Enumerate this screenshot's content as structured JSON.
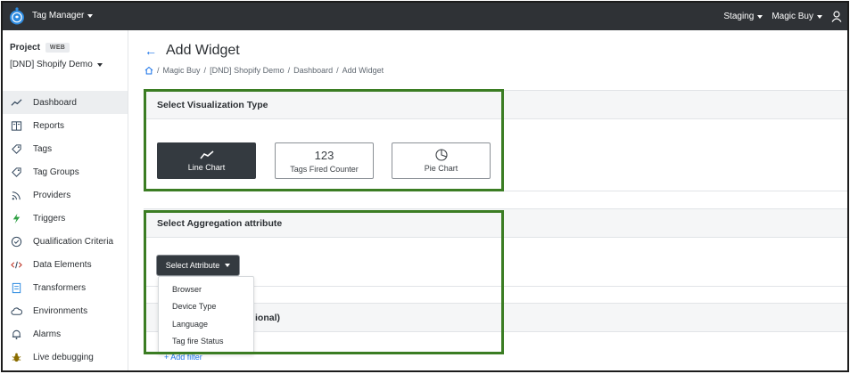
{
  "topbar": {
    "app_name": "Tag Manager",
    "environment": "Staging",
    "account": "Magic Buy"
  },
  "sidebar": {
    "project_label": "Project",
    "project_badge": "WEB",
    "project_name": "[DND] Shopify Demo",
    "items": [
      {
        "label": "Dashboard",
        "icon": "trend-icon",
        "active": true
      },
      {
        "label": "Reports",
        "icon": "book-icon"
      },
      {
        "label": "Tags",
        "icon": "tag-icon"
      },
      {
        "label": "Tag Groups",
        "icon": "tag-icon"
      },
      {
        "label": "Providers",
        "icon": "rss-icon"
      },
      {
        "label": "Triggers",
        "icon": "bolt-icon"
      },
      {
        "label": "Qualification Criteria",
        "icon": "check-circle-icon"
      },
      {
        "label": "Data Elements",
        "icon": "code-icon"
      },
      {
        "label": "Transformers",
        "icon": "file-icon"
      },
      {
        "label": "Environments",
        "icon": "cloud-icon"
      },
      {
        "label": "Alarms",
        "icon": "bell-icon"
      },
      {
        "label": "Live debugging",
        "icon": "bug-icon"
      }
    ]
  },
  "page": {
    "title": "Add Widget",
    "breadcrumb": [
      "Magic Buy",
      "[DND] Shopify Demo",
      "Dashboard",
      "Add Widget"
    ]
  },
  "visualization": {
    "header": "Select Visualization Type",
    "options": [
      {
        "label": "Line Chart",
        "glyph": "",
        "selected": true
      },
      {
        "label": "Tags Fired Counter",
        "glyph": "123",
        "selected": false
      },
      {
        "label": "Pie Chart",
        "glyph": "",
        "selected": false
      }
    ]
  },
  "aggregation": {
    "header": "Select Aggregation attribute",
    "button_label": "Select Attribute",
    "options": [
      "Browser",
      "Device Type",
      "Language",
      "Tag fire Status"
    ]
  },
  "filters": {
    "partial_header": "ional)",
    "add_filter": "+ Add filter"
  },
  "colors": {
    "highlight": "#3b7d23",
    "topbar": "#2f3236",
    "link": "#1a73e8"
  }
}
